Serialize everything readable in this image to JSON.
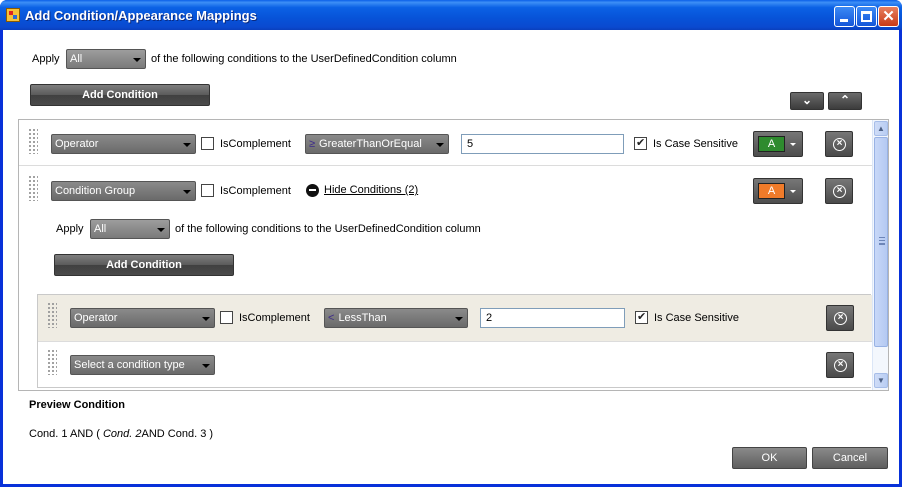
{
  "window": {
    "title": "Add Condition/Appearance Mappings",
    "controls": [
      "minimize",
      "maximize",
      "close"
    ],
    "close_glyph": "✕"
  },
  "top": {
    "apply_label": "Apply",
    "apply_value": "All",
    "suffix": "of the following conditions to the UserDefinedCondition column",
    "add_condition": "Add Condition"
  },
  "move": {
    "down": "⌄",
    "up": "⌃"
  },
  "rows": {
    "r1": {
      "type": "Operator",
      "complement": "IsComplement",
      "operator_symbol": "≥",
      "operator": "GreaterThanOrEqual",
      "value": "5",
      "case_label": "Is Case Sensitive",
      "swatch_text": "A",
      "swatch_color": "#2e8b2e"
    },
    "r2": {
      "type": "Condition Group",
      "complement": "IsComplement",
      "hide_link": "Hide Conditions (2)",
      "swatch_text": "A",
      "swatch_color": "#f07b2a",
      "apply_label": "Apply",
      "apply_value": "All",
      "suffix": "of the following conditions to the UserDefinedCondition column",
      "add_condition": "Add Condition"
    },
    "r3": {
      "type": "Operator",
      "complement": "IsComplement",
      "operator_symbol": "<",
      "operator": "LessThan",
      "value": "2",
      "case_label": "Is Case Sensitive"
    },
    "r4": {
      "type": "Select a condition type"
    }
  },
  "preview": {
    "title": "Preview Condition",
    "part1": "Cond. 1 AND (",
    "part2": "Cond. 2",
    "part3": "AND Cond. 3 )"
  },
  "footer": {
    "ok": "OK",
    "cancel": "Cancel"
  },
  "icons": {
    "delete": "remove-condition-icon",
    "grip": "drag-handle-icon"
  }
}
